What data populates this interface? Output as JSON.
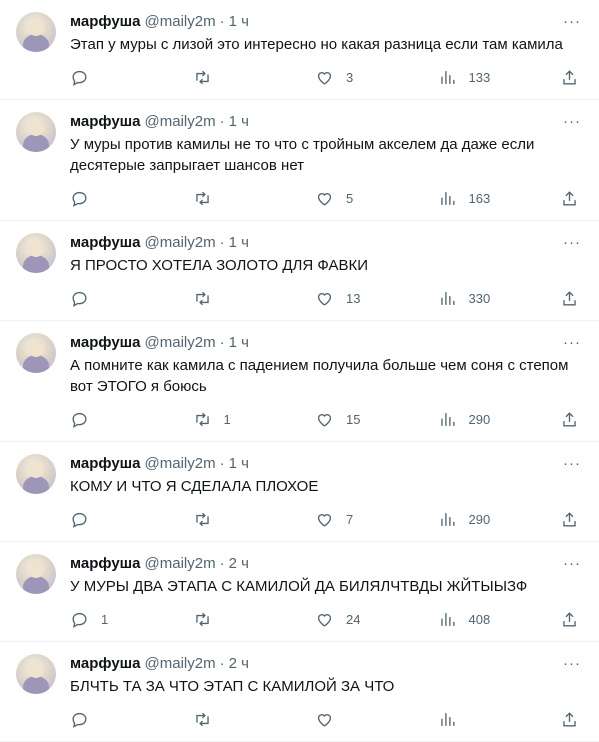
{
  "tweets": [
    {
      "name": "марфуша",
      "handle": "@maily2m",
      "time": "1 ч",
      "text": "Этап у муры с лизой это интересно но какая разница если там камила",
      "reply_count": "",
      "retweet_count": "",
      "like_count": "3",
      "view_count": "133"
    },
    {
      "name": "марфуша",
      "handle": "@maily2m",
      "time": "1 ч",
      "text": "У муры против камилы не то что с тройным акселем да даже если десятерые запрыгает шансов нет",
      "reply_count": "",
      "retweet_count": "",
      "like_count": "5",
      "view_count": "163"
    },
    {
      "name": "марфуша",
      "handle": "@maily2m",
      "time": "1 ч",
      "text": "Я ПРОСТО ХОТЕЛА ЗОЛОТО ДЛЯ ФАВКИ",
      "reply_count": "",
      "retweet_count": "",
      "like_count": "13",
      "view_count": "330"
    },
    {
      "name": "марфуша",
      "handle": "@maily2m",
      "time": "1 ч",
      "text": "А помните как камила с падением получила больше чем соня с степом вот ЭТОГО я боюсь",
      "reply_count": "",
      "retweet_count": "1",
      "like_count": "15",
      "view_count": "290"
    },
    {
      "name": "марфуша",
      "handle": "@maily2m",
      "time": "1 ч",
      "text": "КОМУ И ЧТО Я СДЕЛАЛА ПЛОХОЕ",
      "reply_count": "",
      "retweet_count": "",
      "like_count": "7",
      "view_count": "290"
    },
    {
      "name": "марфуша",
      "handle": "@maily2m",
      "time": "2 ч",
      "text": "У МУРЫ ДВА ЭТАПА С КАМИЛОЙ ДА БИЛЯЛЧТВДЫ ЖЙТЫЫЗФ",
      "reply_count": "1",
      "retweet_count": "",
      "like_count": "24",
      "view_count": "408"
    },
    {
      "name": "марфуша",
      "handle": "@maily2m",
      "time": "2 ч",
      "text": "БЛЧТЬ ТА ЗА ЧТО ЭТАП С КАМИЛОЙ ЗА ЧТО",
      "reply_count": "",
      "retweet_count": "",
      "like_count": "",
      "view_count": ""
    }
  ],
  "ui": {
    "separator": "·",
    "more_glyph": "···"
  }
}
